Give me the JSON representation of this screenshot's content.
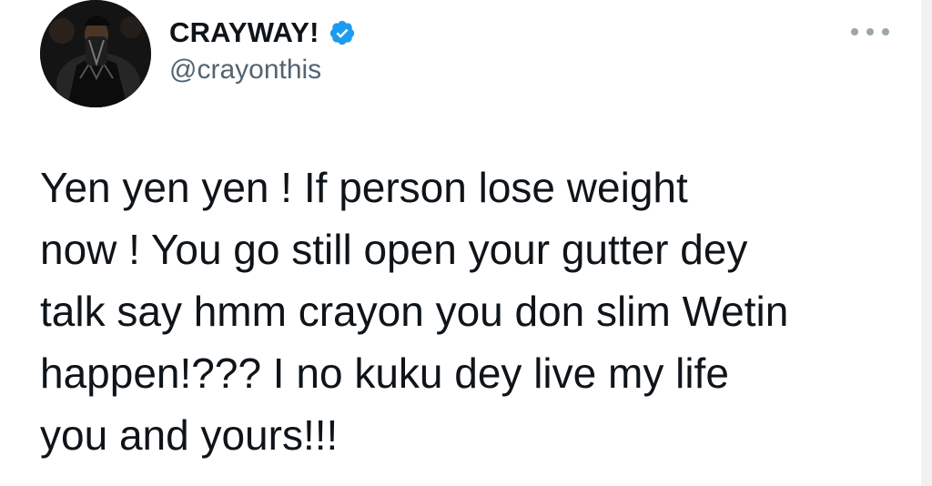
{
  "author": {
    "display_name": "CRAYWAY!",
    "handle": "@crayonthis",
    "verified_icon": "verified-badge-icon",
    "verified_color": "#1d9bf0"
  },
  "more_icon": "more-options-icon",
  "tweet": {
    "text": "Yen yen yen ! If person lose weight\nnow ! You go still open your gutter dey\ntalk say hmm crayon you don slim Wetin\nhappen!??? I no kuku dey live my life\nyou and yours!!!"
  },
  "colors": {
    "text": "#0f1419",
    "secondary_text": "#536471",
    "accent": "#1d9bf0"
  }
}
